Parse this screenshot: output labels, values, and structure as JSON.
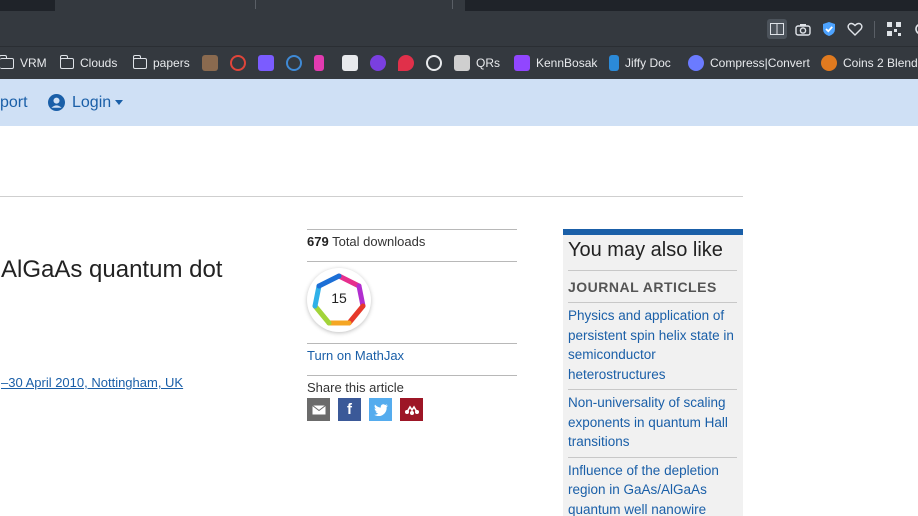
{
  "browser": {
    "bookmarks": [
      {
        "label": "VRM",
        "type": "folder"
      },
      {
        "label": "Clouds",
        "type": "folder"
      },
      {
        "label": "papers",
        "type": "folder"
      },
      {
        "label": "QRs",
        "type": "site"
      },
      {
        "label": "KennBosak",
        "type": "site"
      },
      {
        "label": "Jiffy Doc",
        "type": "site"
      },
      {
        "label": "Compress|Convert",
        "type": "site"
      },
      {
        "label": "Coins 2 Blend",
        "type": "site"
      }
    ],
    "toolbar_icons": [
      "reader-icon",
      "screenshot-icon",
      "shield-icon",
      "heart-icon",
      "qr-icon"
    ]
  },
  "nav": {
    "partial_link": "port",
    "login_label": "Login"
  },
  "article": {
    "title_fragment": "AlGaAs quantum dot",
    "conference_fragment": "–30 April 2010, Nottingham, UK"
  },
  "metrics": {
    "downloads_count": "679",
    "downloads_label": "Total downloads",
    "altmetric_score": "15",
    "mathjax_label": "Turn on MathJax",
    "share_label": "Share this article",
    "share_icons": [
      "email-icon",
      "facebook-icon",
      "twitter-icon",
      "mendeley-icon"
    ]
  },
  "sidebar": {
    "heading": "You may also like",
    "section_label": "JOURNAL ARTICLES",
    "articles": [
      "Physics and application of persistent spin helix state in semiconductor heterostructures",
      "Non-universality of scaling exponents in quantum Hall transitions",
      "Influence of the depletion region in GaAs/AlGaAs quantum well nanowire"
    ]
  },
  "colors": {
    "nav_bg": "#cfe0f5",
    "link": "#1a5fa8",
    "chrome_bg": "#34393f"
  }
}
